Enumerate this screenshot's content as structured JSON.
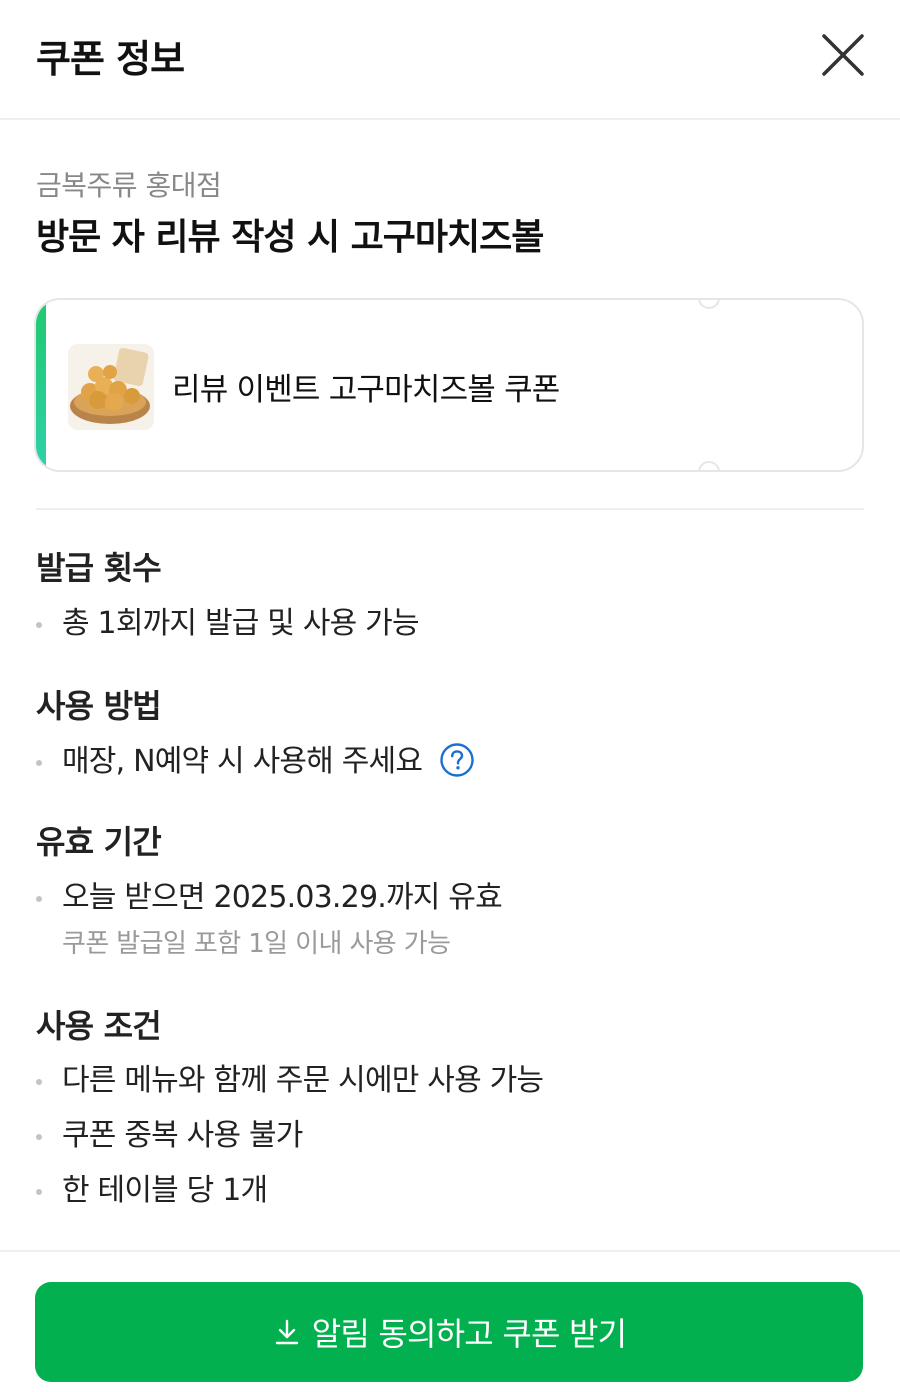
{
  "header": {
    "title": "쿠폰 정보",
    "close_icon": "close-icon"
  },
  "store": {
    "name": "금복주류 홍대점"
  },
  "coupon": {
    "title": "방문 자 리뷰 작성 시 고구마치즈볼",
    "card_name": "리뷰 이벤트 고구마치즈볼 쿠폰",
    "accent_color": "#21c96f"
  },
  "sections": {
    "issue": {
      "title": "발급 횟수",
      "items": [
        "총 1회까지 발급 및 사용 가능"
      ]
    },
    "usage": {
      "title": "사용 방법",
      "items": [
        "매장, N예약 시 사용해 주세요"
      ],
      "help_icon": "question-circle-icon"
    },
    "validity": {
      "title": "유효 기간",
      "items": [
        "오늘 받으면 2025.03.29.까지 유효"
      ],
      "note": "쿠폰 발급일 포함 1일 이내 사용 가능"
    },
    "conditions": {
      "title": "사용 조건",
      "items": [
        "다른 메뉴와 함께 주문 시에만 사용 가능",
        "쿠폰 중복 사용 불가",
        "한 테이블 당 1개"
      ]
    }
  },
  "cta": {
    "label": "알림 동의하고 쿠폰 받기",
    "icon": "download-icon",
    "color": "#03b050"
  }
}
